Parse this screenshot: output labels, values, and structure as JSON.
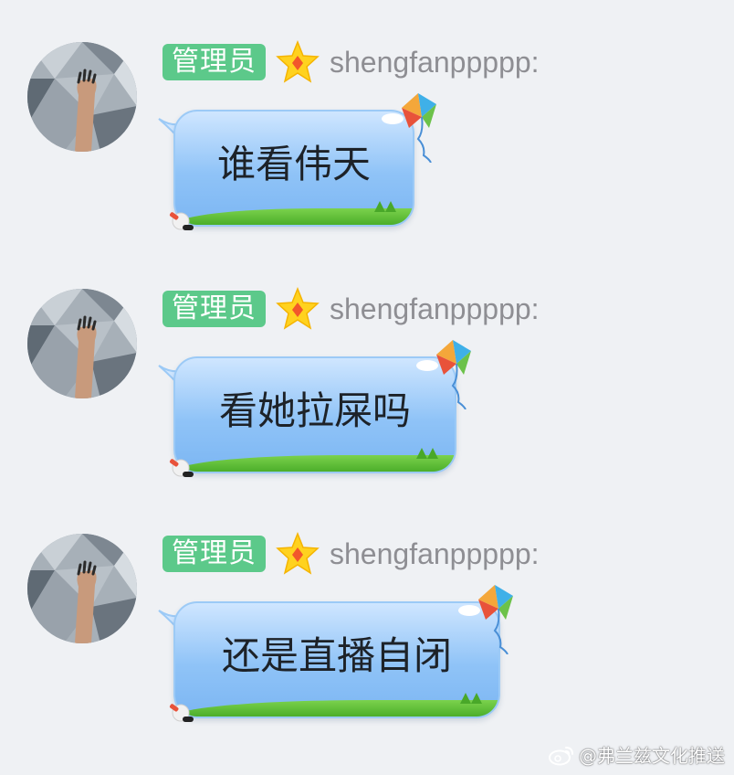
{
  "messages": [
    {
      "role_badge": "管理员",
      "rank_icon": "star-icon",
      "username": "shengfanppppp:",
      "text": "谁看伟天",
      "bubble_theme": "kite-sky"
    },
    {
      "role_badge": "管理员",
      "rank_icon": "star-icon",
      "username": "shengfanppppp:",
      "text": "看她拉屎吗",
      "bubble_theme": "kite-sky"
    },
    {
      "role_badge": "管理员",
      "rank_icon": "star-icon",
      "username": "shengfanppppp:",
      "text": "还是直播自闭",
      "bubble_theme": "kite-sky"
    }
  ],
  "watermark": {
    "icon": "weibo-icon",
    "text": "@弗兰兹文化推送"
  },
  "colors": {
    "background": "#eff1f4",
    "badge": "#5cc98a",
    "username": "#8e8e93",
    "bubble_top": "#cfe6ff",
    "bubble_bottom": "#7cb6f3",
    "grass": "#4cae2a"
  }
}
